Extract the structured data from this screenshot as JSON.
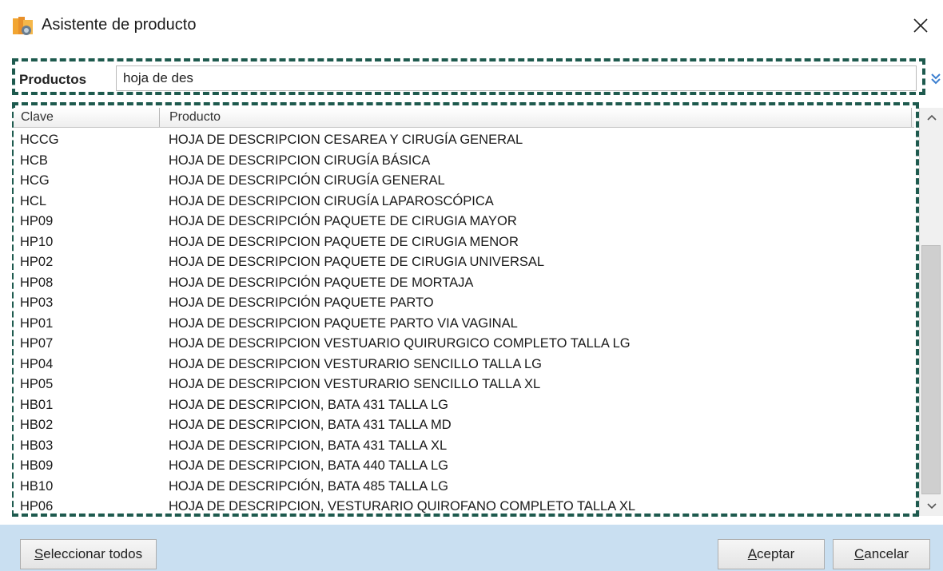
{
  "window": {
    "title": "Asistente de producto"
  },
  "search": {
    "label": "Productos",
    "value": "hoja de des"
  },
  "grid": {
    "columns": [
      "Clave",
      "Producto"
    ],
    "rows": [
      [
        "HCCG",
        "HOJA DE DESCRIPCION CESAREA Y CIRUGÍA GENERAL"
      ],
      [
        "HCB",
        "HOJA DE DESCRIPCION CIRUGÍA BÁSICA"
      ],
      [
        "HCG",
        "HOJA DE DESCRIPCIÓN CIRUGÍA GENERAL"
      ],
      [
        "HCL",
        "HOJA DE DESCRIPCION CIRUGÍA LAPAROSCÓPICA"
      ],
      [
        "HP09",
        "HOJA DE DESCRIPCIÓN PAQUETE DE CIRUGIA MAYOR"
      ],
      [
        "HP10",
        "HOJA DE DESCRIPCION PAQUETE DE CIRUGIA MENOR"
      ],
      [
        "HP02",
        "HOJA DE DESCRIPCION PAQUETE DE CIRUGIA UNIVERSAL"
      ],
      [
        "HP08",
        "HOJA DE DESCRIPCIÓN PAQUETE DE MORTAJA"
      ],
      [
        "HP03",
        "HOJA DE DESCRIPCIÓN PAQUETE PARTO"
      ],
      [
        "HP01",
        "HOJA DE DESCRIPCION PAQUETE PARTO VIA VAGINAL"
      ],
      [
        "HP07",
        "HOJA DE DESCRIPCION VESTUARIO QUIRURGICO COMPLETO TALLA LG"
      ],
      [
        "HP04",
        "HOJA DE DESCRIPCION VESTURARIO SENCILLO TALLA LG"
      ],
      [
        "HP05",
        "HOJA DE DESCRIPCION VESTURARIO SENCILLO TALLA XL"
      ],
      [
        "HB01",
        "HOJA DE DESCRIPCION, BATA 431 TALLA LG"
      ],
      [
        "HB02",
        "HOJA DE DESCRIPCION, BATA 431 TALLA MD"
      ],
      [
        "HB03",
        "HOJA DE DESCRIPCION, BATA 431 TALLA XL"
      ],
      [
        "HB09",
        "HOJA DE DESCRIPCION, BATA 440 TALLA LG"
      ],
      [
        "HB10",
        "HOJA DE DESCRIPCIÓN, BATA 485 TALLA LG"
      ],
      [
        "HP06",
        "HOJA DE DESCRIPCION, VESTURARIO QUIROFANO COMPLETO TALLA XL"
      ]
    ]
  },
  "buttons": {
    "select_all": {
      "mnemonic": "S",
      "rest": "eleccionar todos"
    },
    "accept": {
      "mnemonic": "A",
      "rest": "ceptar"
    },
    "cancel": {
      "mnemonic": "C",
      "rest": "ancelar"
    }
  },
  "colors": {
    "highlight_dashes": "#1e5a4e",
    "footer": "#c9dff1"
  },
  "icons": [
    "app-icon",
    "close-icon",
    "expand-chevrons-icon",
    "scroll-up-icon",
    "scroll-down-icon"
  ]
}
